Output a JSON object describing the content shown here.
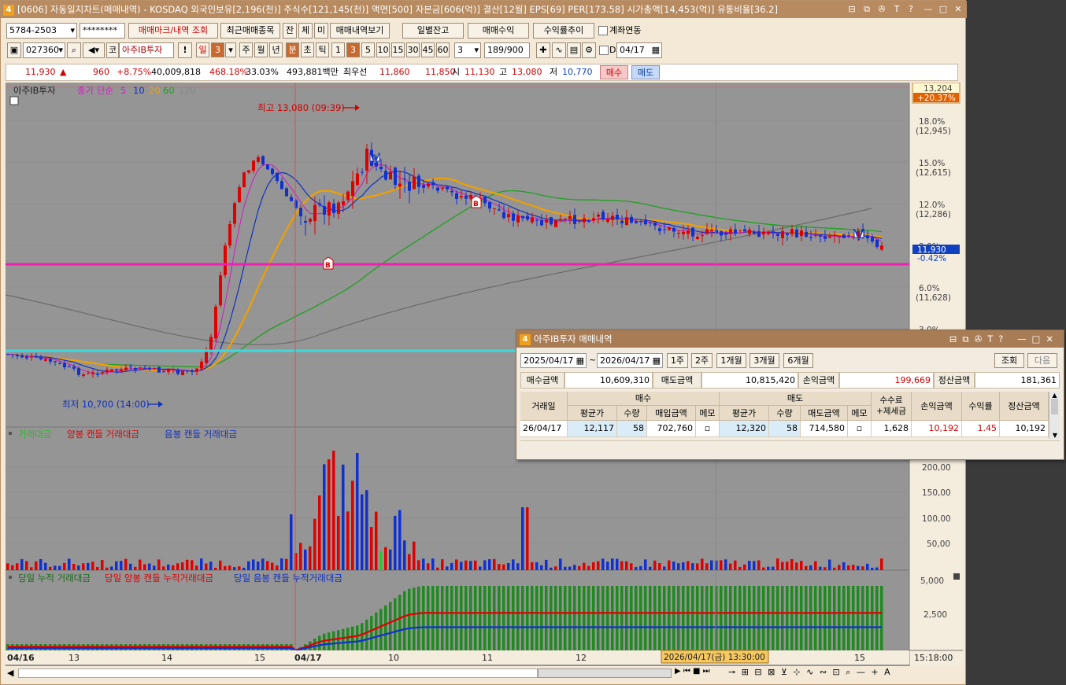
{
  "window": {
    "badge": "4",
    "title": "[0606] 자동일지차트(매매내역) - KOSDAQ 외국인보유[2,196(천)] 주식수[121,145(천)] 액면[500] 자본금[606(억)] 결산[12월] EPS[69] PER[173.58] 시가총액[14,453(억)] 유통비율[36.2]",
    "title_icons": [
      "layout-icon",
      "copy-icon",
      "pin-icon",
      "text-icon",
      "help-icon",
      "minimize-icon",
      "maximize-icon",
      "close-icon"
    ],
    "title_glyphs": [
      "⊟",
      "⧉",
      "✇",
      "T",
      "?",
      "—",
      "□",
      "✕"
    ]
  },
  "toolbar1": {
    "account": "5784-2503",
    "password": "********",
    "buttons": [
      "매매마크/내역 조회",
      "최근매매종목",
      "잔",
      "체",
      "미",
      "매매내역보기"
    ],
    "buttons2": [
      "일별잔고",
      "매매수익",
      "수익률추이"
    ],
    "link_label": "계좌연동"
  },
  "toolbar2": {
    "code": "027360",
    "market": "코",
    "stock_name": "아주IB투자",
    "period_buttons": [
      "일",
      "3",
      "주",
      "월",
      "년",
      "분",
      "초",
      "틱"
    ],
    "minute_buttons": [
      "1",
      "3",
      "5",
      "10",
      "15",
      "30",
      "45",
      "60"
    ],
    "interval_select": "3",
    "count": "189",
    "count_max": "/900",
    "d_label": "D",
    "date": "04/17"
  },
  "quote": {
    "price": "11,930",
    "arrow": "▲",
    "change": "960",
    "change_pct": "+8.75%",
    "volume": "40,009,818",
    "vol_ratio": "468.18%",
    "turnover": "33.03%",
    "amount": "493,881백만",
    "best_label": "최우선",
    "ask": "11,860",
    "bid": "11,850",
    "open_label": "시",
    "open": "11,130",
    "high_label": "고",
    "high": "13,080",
    "low_label": "저",
    "low": "10,770",
    "buy_btn": "매수",
    "sell_btn": "매도"
  },
  "price_panel": {
    "legend_name": "아주IB투자",
    "legend_ma": "종가 단순",
    "ma_periods": [
      "5",
      "10",
      "20",
      "60",
      "120"
    ],
    "ma_colors": [
      "#e040e0",
      "#1030c0",
      "#f0a000",
      "#20a020",
      "#808080"
    ],
    "high_label": "최고 13,080 (09:39)",
    "low_label": "최저 10,700 (14:00)",
    "current_badge_top": "13,204",
    "current_badge_bottom": "+20.37%",
    "last_price_badge": "11,930",
    "last_pct_badge": "-0.42%",
    "axis": [
      {
        "pct": "18.0%",
        "price": "(12,945)"
      },
      {
        "pct": "15.0%",
        "price": "(12,615)"
      },
      {
        "pct": "12.0%",
        "price": "(12,286)"
      },
      {
        "pct": "9.0%",
        "price": ""
      },
      {
        "pct": "6.0%",
        "price": "(11,628)"
      },
      {
        "pct": "3.0%",
        "price": ""
      }
    ],
    "markers": [
      "B",
      "S",
      "B",
      "S"
    ]
  },
  "volume_panel": {
    "legend": [
      "거래대금",
      "양봉 캔들 거래대금",
      "음봉 캔들 거래대금"
    ],
    "axis": [
      "200,00",
      "150,00",
      "100,00",
      "50,00"
    ]
  },
  "cum_panel": {
    "legend": [
      "당일 누적 거래대금",
      "당일 양봉 캔들 누적거래대금",
      "당일 음봉 캔들 누적거래대금"
    ],
    "axis": [
      "5,000",
      "2,500"
    ]
  },
  "x_axis": {
    "labels": [
      "04/16",
      "13",
      "14",
      "15",
      "04/17",
      "10",
      "11",
      "12",
      "15"
    ],
    "cursor_label": "2026/04/17(금) 13:30:00",
    "time": "15:18:00"
  },
  "popup": {
    "badge": "4",
    "title": "아주IB투자 매매내역",
    "date_from": "2025/04/17",
    "date_to": "2026/04/17",
    "tilde": "~",
    "range_buttons": [
      "1주",
      "2주",
      "1개월",
      "3개월",
      "6개월"
    ],
    "query_btn": "조회",
    "next_btn": "다음",
    "summary": {
      "buy_label": "매수금액",
      "buy": "10,609,310",
      "sell_label": "매도금액",
      "sell": "10,815,420",
      "pl_label": "손익금액",
      "pl": "199,669",
      "settle_label": "정산금액",
      "settle": "181,361"
    },
    "headers": {
      "date": "거래일",
      "buy_group": "매수",
      "sell_group": "매도",
      "fee": "수수료\n+제세금",
      "pl": "손익금액",
      "rate": "수익률",
      "settle": "정산금액",
      "buy_cols": [
        "평균가",
        "수량",
        "매입금액",
        "메모"
      ],
      "sell_cols": [
        "평균가",
        "수량",
        "매도금액",
        "메모"
      ]
    },
    "rows": [
      {
        "date": "26/04/17",
        "buy_avg": "12,117",
        "buy_qty": "58",
        "buy_amt": "702,760",
        "sell_avg": "12,320",
        "sell_qty": "58",
        "sell_amt": "714,580",
        "fee": "1,628",
        "pl": "10,192",
        "rate": "1.45",
        "settle": "10,192"
      }
    ]
  }
}
